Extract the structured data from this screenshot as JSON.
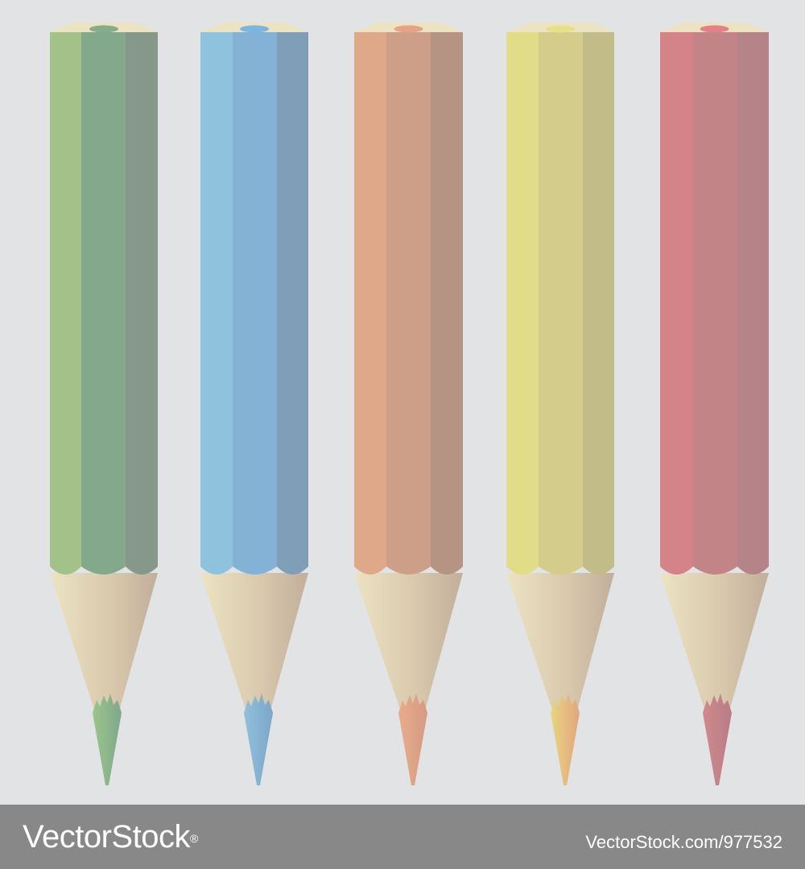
{
  "pencils": [
    {
      "name": "green",
      "light": "#a2c28a",
      "mid": "#84a88c",
      "dark": "#85988a",
      "core": "#86ac8c",
      "tip": [
        "#9cc48a",
        "#7fa78c"
      ]
    },
    {
      "name": "blue",
      "light": "#8fc2dc",
      "mid": "#84b2d7",
      "dark": "#7f9eb7",
      "core": "#7fb4de",
      "tip": [
        "#8ec0dc",
        "#7ea6c8"
      ]
    },
    {
      "name": "orange",
      "light": "#dfa888",
      "mid": "#cd9f88",
      "dark": "#b59484",
      "core": "#e6a486",
      "tip": [
        "#e8ad8a",
        "#d49a84"
      ]
    },
    {
      "name": "yellow",
      "light": "#e0dc88",
      "mid": "#d3cc8b",
      "dark": "#c1bc88",
      "core": "#e6e08a",
      "tip": [
        "#e8d480",
        "#e2a57e"
      ]
    },
    {
      "name": "red",
      "light": "#d48488",
      "mid": "#c38488",
      "dark": "#b48489",
      "core": "#e08288",
      "tip": [
        "#d08a8c",
        "#b87c86"
      ]
    }
  ],
  "colors": {
    "background": "#e2e3e4",
    "wood_light": "#ece3c2",
    "wood_dark": "#c2ae9a",
    "watermark_bar": "#888888"
  },
  "watermark": {
    "logo": "VectorStock",
    "registered": "®",
    "url": "VectorStock.com/977532"
  }
}
